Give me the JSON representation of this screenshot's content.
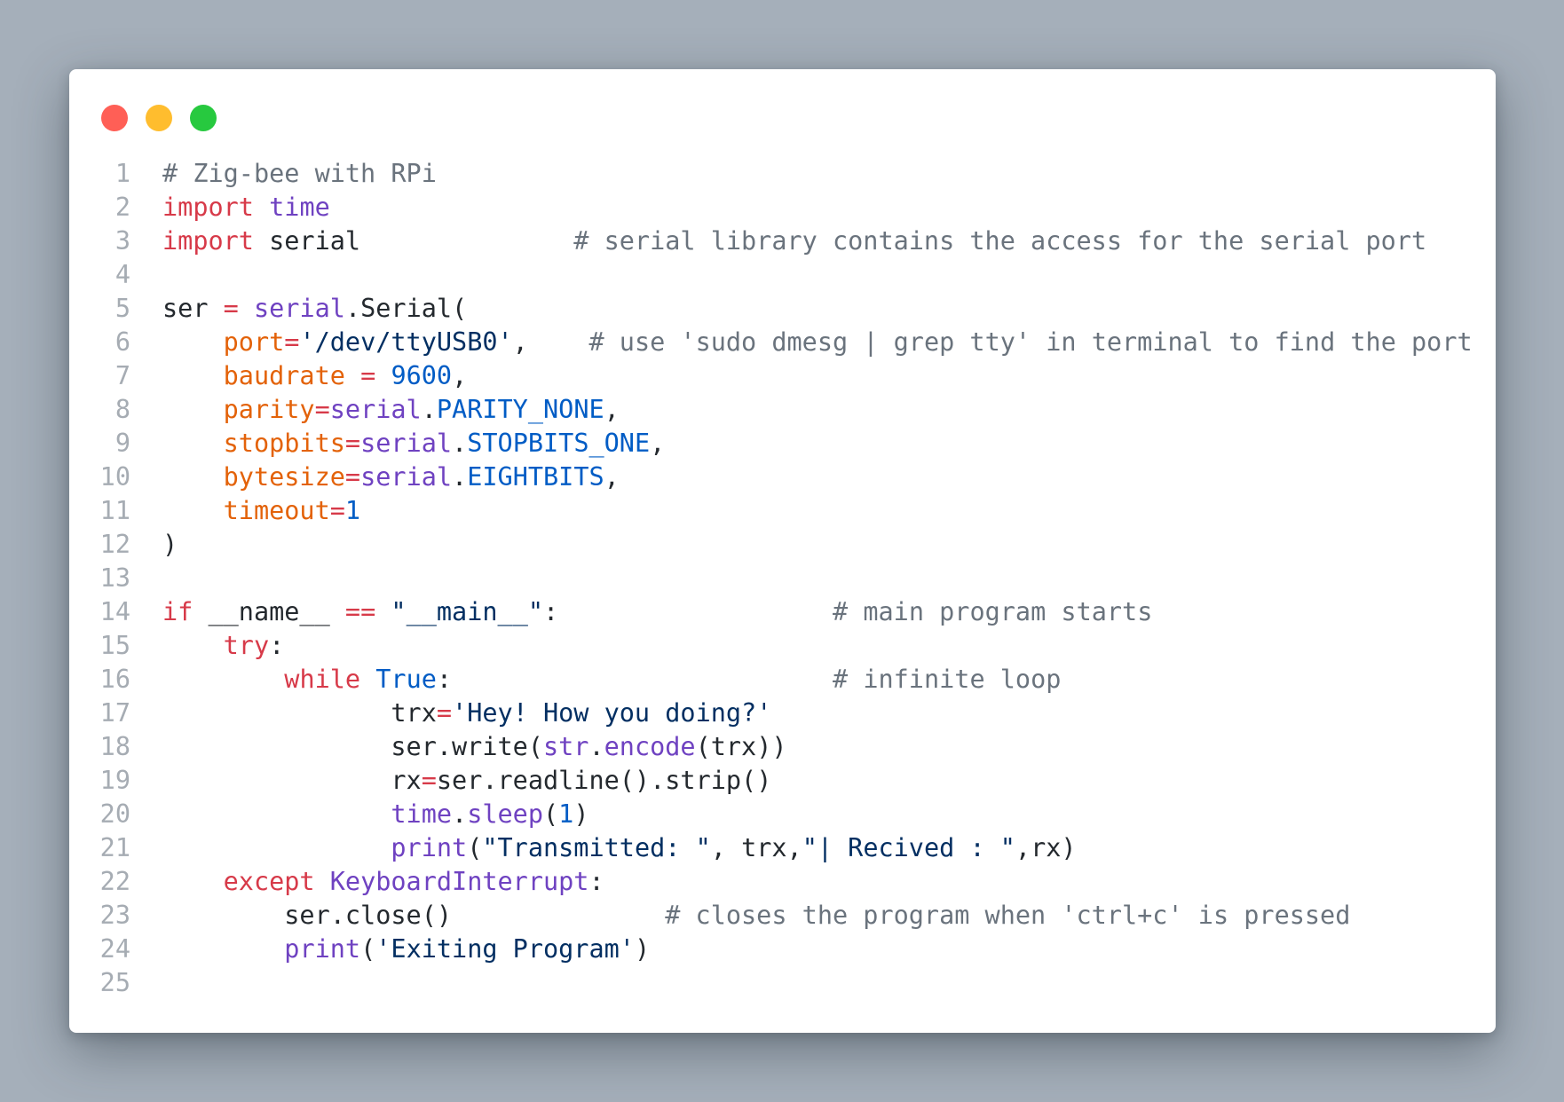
{
  "window": {
    "controls": [
      {
        "name": "close",
        "color": "#ff5f56"
      },
      {
        "name": "minimize",
        "color": "#ffbd2e"
      },
      {
        "name": "zoom",
        "color": "#27c93f"
      }
    ]
  },
  "code": {
    "language": "python",
    "lines": [
      {
        "n": "1",
        "tokens": [
          {
            "t": "# Zig-bee with RPi",
            "k": "com"
          }
        ]
      },
      {
        "n": "2",
        "tokens": [
          {
            "t": "import",
            "k": "kw"
          },
          {
            "t": " ",
            "k": "txt"
          },
          {
            "t": "time",
            "k": "mod"
          }
        ]
      },
      {
        "n": "3",
        "tokens": [
          {
            "t": "import",
            "k": "kw"
          },
          {
            "t": " serial              ",
            "k": "txt"
          },
          {
            "t": "# serial library contains the access for the serial port",
            "k": "com"
          }
        ]
      },
      {
        "n": "4",
        "tokens": []
      },
      {
        "n": "5",
        "tokens": [
          {
            "t": "ser ",
            "k": "txt"
          },
          {
            "t": "=",
            "k": "op"
          },
          {
            "t": " ",
            "k": "txt"
          },
          {
            "t": "serial",
            "k": "mod"
          },
          {
            "t": ".Serial(",
            "k": "txt"
          }
        ]
      },
      {
        "n": "6",
        "tokens": [
          {
            "t": "    ",
            "k": "txt"
          },
          {
            "t": "port",
            "k": "prm"
          },
          {
            "t": "=",
            "k": "op"
          },
          {
            "t": "'/dev/ttyUSB0'",
            "k": "str"
          },
          {
            "t": ",    ",
            "k": "txt"
          },
          {
            "t": "# use 'sudo dmesg | grep tty' in terminal to find the port",
            "k": "com"
          }
        ]
      },
      {
        "n": "7",
        "tokens": [
          {
            "t": "    ",
            "k": "txt"
          },
          {
            "t": "baudrate",
            "k": "prm"
          },
          {
            "t": " ",
            "k": "txt"
          },
          {
            "t": "=",
            "k": "op"
          },
          {
            "t": " ",
            "k": "txt"
          },
          {
            "t": "9600",
            "k": "num"
          },
          {
            "t": ",",
            "k": "txt"
          }
        ]
      },
      {
        "n": "8",
        "tokens": [
          {
            "t": "    ",
            "k": "txt"
          },
          {
            "t": "parity",
            "k": "prm"
          },
          {
            "t": "=",
            "k": "op"
          },
          {
            "t": "serial",
            "k": "mod"
          },
          {
            "t": ".",
            "k": "txt"
          },
          {
            "t": "PARITY_NONE",
            "k": "con"
          },
          {
            "t": ",",
            "k": "txt"
          }
        ]
      },
      {
        "n": "9",
        "tokens": [
          {
            "t": "    ",
            "k": "txt"
          },
          {
            "t": "stopbits",
            "k": "prm"
          },
          {
            "t": "=",
            "k": "op"
          },
          {
            "t": "serial",
            "k": "mod"
          },
          {
            "t": ".",
            "k": "txt"
          },
          {
            "t": "STOPBITS_ONE",
            "k": "con"
          },
          {
            "t": ",",
            "k": "txt"
          }
        ]
      },
      {
        "n": "10",
        "tokens": [
          {
            "t": "    ",
            "k": "txt"
          },
          {
            "t": "bytesize",
            "k": "prm"
          },
          {
            "t": "=",
            "k": "op"
          },
          {
            "t": "serial",
            "k": "mod"
          },
          {
            "t": ".",
            "k": "txt"
          },
          {
            "t": "EIGHTBITS",
            "k": "con"
          },
          {
            "t": ",",
            "k": "txt"
          }
        ]
      },
      {
        "n": "11",
        "tokens": [
          {
            "t": "    ",
            "k": "txt"
          },
          {
            "t": "timeout",
            "k": "prm"
          },
          {
            "t": "=",
            "k": "op"
          },
          {
            "t": "1",
            "k": "num"
          }
        ]
      },
      {
        "n": "12",
        "tokens": [
          {
            "t": ")",
            "k": "txt"
          }
        ]
      },
      {
        "n": "13",
        "tokens": []
      },
      {
        "n": "14",
        "tokens": [
          {
            "t": "if",
            "k": "kw"
          },
          {
            "t": " __name__ ",
            "k": "txt"
          },
          {
            "t": "==",
            "k": "op"
          },
          {
            "t": " ",
            "k": "txt"
          },
          {
            "t": "\"__main__\"",
            "k": "str"
          },
          {
            "t": ":                  ",
            "k": "txt"
          },
          {
            "t": "# main program starts",
            "k": "com"
          }
        ]
      },
      {
        "n": "15",
        "tokens": [
          {
            "t": "    ",
            "k": "txt"
          },
          {
            "t": "try",
            "k": "kw"
          },
          {
            "t": ":",
            "k": "txt"
          }
        ]
      },
      {
        "n": "16",
        "tokens": [
          {
            "t": "        ",
            "k": "txt"
          },
          {
            "t": "while",
            "k": "kw"
          },
          {
            "t": " ",
            "k": "txt"
          },
          {
            "t": "True",
            "k": "con"
          },
          {
            "t": ":                         ",
            "k": "txt"
          },
          {
            "t": "# infinite loop",
            "k": "com"
          }
        ]
      },
      {
        "n": "17",
        "tokens": [
          {
            "t": "               trx",
            "k": "txt"
          },
          {
            "t": "=",
            "k": "op"
          },
          {
            "t": "'Hey! How you doing?'",
            "k": "str"
          }
        ]
      },
      {
        "n": "18",
        "tokens": [
          {
            "t": "               ser.write(",
            "k": "txt"
          },
          {
            "t": "str",
            "k": "mod"
          },
          {
            "t": ".",
            "k": "txt"
          },
          {
            "t": "encode",
            "k": "mod"
          },
          {
            "t": "(trx))",
            "k": "txt"
          }
        ]
      },
      {
        "n": "19",
        "tokens": [
          {
            "t": "               rx",
            "k": "txt"
          },
          {
            "t": "=",
            "k": "op"
          },
          {
            "t": "ser.readline().strip()",
            "k": "txt"
          }
        ]
      },
      {
        "n": "20",
        "tokens": [
          {
            "t": "               ",
            "k": "txt"
          },
          {
            "t": "time",
            "k": "mod"
          },
          {
            "t": ".",
            "k": "txt"
          },
          {
            "t": "sleep",
            "k": "mod"
          },
          {
            "t": "(",
            "k": "txt"
          },
          {
            "t": "1",
            "k": "num"
          },
          {
            "t": ")",
            "k": "txt"
          }
        ]
      },
      {
        "n": "21",
        "tokens": [
          {
            "t": "               ",
            "k": "txt"
          },
          {
            "t": "print",
            "k": "mod"
          },
          {
            "t": "(",
            "k": "txt"
          },
          {
            "t": "\"Transmitted: \"",
            "k": "str"
          },
          {
            "t": ", trx,",
            "k": "txt"
          },
          {
            "t": "\"| Recived : \"",
            "k": "str"
          },
          {
            "t": ",rx)",
            "k": "txt"
          }
        ]
      },
      {
        "n": "22",
        "tokens": [
          {
            "t": "    ",
            "k": "txt"
          },
          {
            "t": "except",
            "k": "kw"
          },
          {
            "t": " ",
            "k": "txt"
          },
          {
            "t": "KeyboardInterrupt",
            "k": "mod"
          },
          {
            "t": ":",
            "k": "txt"
          }
        ]
      },
      {
        "n": "23",
        "tokens": [
          {
            "t": "        ser.close()              ",
            "k": "txt"
          },
          {
            "t": "# closes the program when 'ctrl+c' is pressed",
            "k": "com"
          }
        ]
      },
      {
        "n": "24",
        "tokens": [
          {
            "t": "        ",
            "k": "txt"
          },
          {
            "t": "print",
            "k": "mod"
          },
          {
            "t": "(",
            "k": "txt"
          },
          {
            "t": "'Exiting Program'",
            "k": "str"
          },
          {
            "t": ")",
            "k": "txt"
          }
        ]
      },
      {
        "n": "25",
        "tokens": []
      }
    ]
  }
}
